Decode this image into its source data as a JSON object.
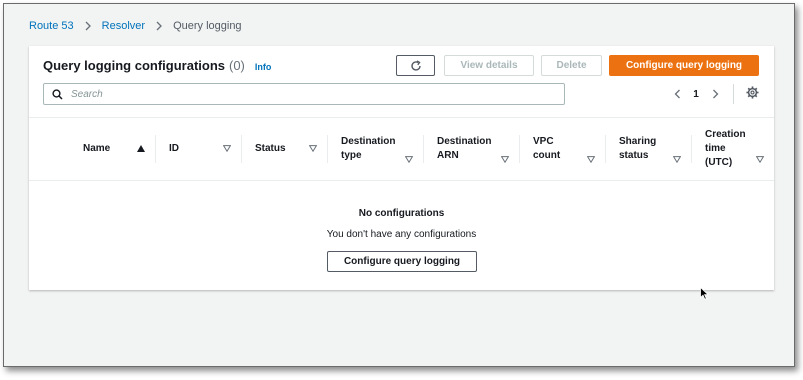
{
  "breadcrumb": {
    "items": [
      {
        "label": "Route 53"
      },
      {
        "label": "Resolver"
      },
      {
        "label": "Query logging"
      }
    ]
  },
  "header": {
    "title": "Query logging configurations",
    "count": "(0)",
    "info": "Info"
  },
  "toolbar": {
    "refresh_icon": "refresh-icon",
    "view_details": "View details",
    "delete": "Delete",
    "configure": "Configure query logging"
  },
  "search": {
    "placeholder": "Search",
    "value": ""
  },
  "pagination": {
    "page": "1"
  },
  "table": {
    "columns": [
      {
        "label": "Name",
        "sort": "ascending"
      },
      {
        "label": "ID"
      },
      {
        "label": "Status"
      },
      {
        "label": "Destination\ntype"
      },
      {
        "label": "Destination\nARN"
      },
      {
        "label": "VPC\ncount"
      },
      {
        "label": "Sharing\nstatus"
      },
      {
        "label": "Creation\ntime\n(UTC)"
      }
    ]
  },
  "empty": {
    "title": "No configurations",
    "message": "You don't have any configurations",
    "button": "Configure query logging"
  },
  "colors": {
    "primary": "#ec7211",
    "link": "#0073bb",
    "background": "#f2f3f3"
  }
}
